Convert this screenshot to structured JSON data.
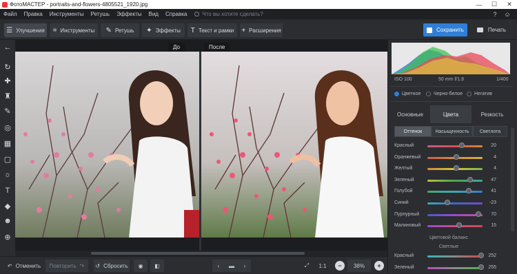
{
  "window": {
    "title": "ФотоМАСТЕР - portraits-and-flowers-4805521_1920.jpg",
    "minimize_glyph": "—",
    "maximize_glyph": "☐",
    "close_glyph": "✕"
  },
  "menu": {
    "items": [
      "Файл",
      "Правка",
      "Инструменты",
      "Ретушь",
      "Эффекты",
      "Вид",
      "Справка"
    ],
    "search_placeholder": "Что вы хотите сделать?",
    "help_glyph": "?",
    "account_glyph": "☺"
  },
  "toolbar": {
    "tabs": [
      {
        "label": "Улучшения",
        "icon": "sliders-icon",
        "glyph": "☰"
      },
      {
        "label": "Инструменты",
        "icon": "crop-icon",
        "glyph": "⌗"
      },
      {
        "label": "Ретушь",
        "icon": "brush-icon",
        "glyph": "✎"
      },
      {
        "label": "Эффекты",
        "icon": "wand-icon",
        "glyph": "✦"
      },
      {
        "label": "Текст и рамки",
        "icon": "text-icon",
        "glyph": "T"
      },
      {
        "label": "Расширения",
        "icon": "plus-icon",
        "glyph": "+"
      }
    ],
    "save_label": "Сохранить",
    "print_label": "Печать"
  },
  "lefttools": [
    {
      "icon": "back-arrow-icon",
      "glyph": "←"
    },
    {
      "icon": "rotate-icon",
      "glyph": "↻"
    },
    {
      "icon": "bandage-icon",
      "glyph": "✚"
    },
    {
      "icon": "stamp-icon",
      "glyph": "♜"
    },
    {
      "icon": "brush-tool-icon",
      "glyph": "✎"
    },
    {
      "icon": "radial-filter-icon",
      "glyph": "◎"
    },
    {
      "icon": "gradient-icon",
      "glyph": "▦"
    },
    {
      "icon": "vignette-icon",
      "glyph": "▢"
    },
    {
      "icon": "light-icon",
      "glyph": "☼"
    },
    {
      "icon": "text-tool-icon",
      "glyph": "T"
    },
    {
      "icon": "fill-icon",
      "glyph": "◆"
    },
    {
      "icon": "face-icon",
      "glyph": "☻"
    },
    {
      "icon": "globe-icon",
      "glyph": "⊕"
    }
  ],
  "canvas": {
    "before_label": "До",
    "after_label": "После"
  },
  "histogram": {
    "iso": "ISO 100",
    "lens": "50 mm f/1.8",
    "shutter": "1/400"
  },
  "color_mode": {
    "options": [
      "Цветное",
      "Черно-белое",
      "Негатив"
    ],
    "selected": "Цветное"
  },
  "panel_tabs": [
    "Основные",
    "Цвета",
    "Резкость"
  ],
  "panel_active": "Цвета",
  "sub_tabs": [
    "Оттенок",
    "Насыщенность",
    "Светлота"
  ],
  "sub_active": "Оттенок",
  "hue_sliders": [
    {
      "label": "Красный",
      "value": "20",
      "pos": 0.62,
      "gradient": [
        "#c65a8c",
        "#d65050",
        "#d48a3a"
      ]
    },
    {
      "label": "Оранжевый",
      "value": "4",
      "pos": 0.52,
      "gradient": [
        "#d05a4a",
        "#d88a3a",
        "#d4b03a"
      ]
    },
    {
      "label": "Желтый",
      "value": "4",
      "pos": 0.52,
      "gradient": [
        "#d48a3a",
        "#d6c23a",
        "#7ab84a"
      ]
    },
    {
      "label": "Зеленый",
      "value": "47",
      "pos": 0.78,
      "gradient": [
        "#b8c23a",
        "#4aa84a",
        "#3aa89a"
      ]
    },
    {
      "label": "Голубой",
      "value": "41",
      "pos": 0.75,
      "gradient": [
        "#4aa86a",
        "#3aaab8",
        "#3a7ad0"
      ]
    },
    {
      "label": "Синий",
      "value": "-23",
      "pos": 0.36,
      "gradient": [
        "#3aaab8",
        "#3a6ad0",
        "#7a4ad0"
      ]
    },
    {
      "label": "Пурпурный",
      "value": "70",
      "pos": 0.92,
      "gradient": [
        "#4a5ad0",
        "#9a4ad0",
        "#d04a9a"
      ]
    },
    {
      "label": "Малиновый",
      "value": "15",
      "pos": 0.58,
      "gradient": [
        "#9a4ad0",
        "#d04a8a",
        "#d04a4a"
      ]
    }
  ],
  "balance": {
    "title": "Цветовой баланс",
    "sub": "Светлые",
    "sliders": [
      {
        "label": "Красный",
        "value": "252",
        "pos": 0.97,
        "gradient": [
          "#3ab8b8",
          "#8a8a8a",
          "#d04a4a"
        ]
      },
      {
        "label": "Зеленый",
        "value": "255",
        "pos": 0.98,
        "gradient": [
          "#c04ac0",
          "#8a8a8a",
          "#4ab84a"
        ]
      }
    ]
  },
  "bottombar": {
    "undo_label": "Отменить",
    "redo_label": "Повторить",
    "reset_label": "Сбросить",
    "zoom_ratio": "1:1",
    "zoom_value": "38%",
    "prev_glyph": "‹",
    "next_glyph": "›",
    "zoom_out_glyph": "−",
    "zoom_in_glyph": "+"
  }
}
